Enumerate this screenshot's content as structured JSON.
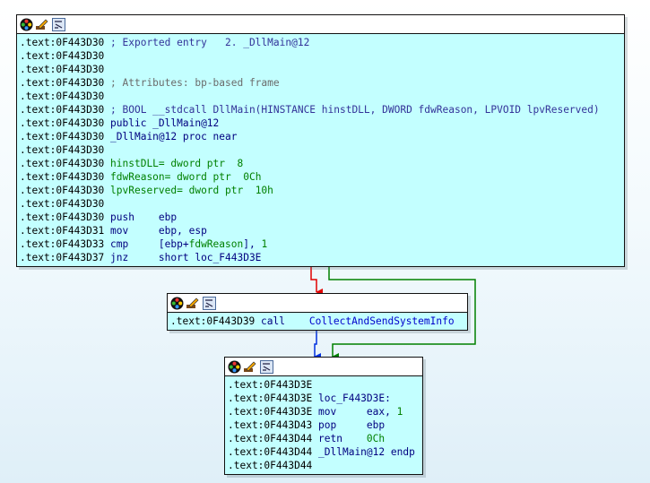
{
  "icons": [
    "color-palette-icon",
    "edit-pencil-icon",
    "graph-layout-icon"
  ],
  "colors": {
    "block_bg": "#c3ffff",
    "edge_true": "#e00000",
    "edge_false": "#008000",
    "edge_uncond": "#0030e0"
  },
  "block1": {
    "lines": [
      {
        "addr": ".text:0F443D30",
        "text": " ; Exported entry   2. _DllMain@12"
      },
      {
        "addr": ".text:0F443D30",
        "text": ""
      },
      {
        "addr": ".text:0F443D30",
        "text": ""
      },
      {
        "addr": ".text:0F443D30",
        "text": " ; Attributes: bp-based frame"
      },
      {
        "addr": ".text:0F443D30",
        "text": ""
      },
      {
        "addr": ".text:0F443D30",
        "text": " ; BOOL __stdcall DllMain(HINSTANCE hinstDLL, DWORD fdwReason, LPVOID lpvReserved)"
      },
      {
        "addr": ".text:0F443D30",
        "text": " public _DllMain@12"
      },
      {
        "addr": ".text:0F443D30",
        "text": " _DllMain@12 proc near"
      },
      {
        "addr": ".text:0F443D30",
        "text": ""
      },
      {
        "addr": ".text:0F443D30",
        "text": " hinstDLL= dword ptr  8"
      },
      {
        "addr": ".text:0F443D30",
        "text": " fdwReason= dword ptr  0Ch"
      },
      {
        "addr": ".text:0F443D30",
        "text": " lpvReserved= dword ptr  10h"
      },
      {
        "addr": ".text:0F443D30",
        "text": ""
      },
      {
        "addr": ".text:0F443D30",
        "text": " push    ebp"
      },
      {
        "addr": ".text:0F443D31",
        "text": " mov     ebp, esp"
      },
      {
        "addr": ".text:0F443D33",
        "text": " cmp     [ebp+fdwReason], 1"
      },
      {
        "addr": ".text:0F443D37",
        "text": " jnz     short loc_F443D3E"
      }
    ]
  },
  "block2": {
    "lines": [
      {
        "addr": ".text:0F443D39",
        "text": " call    CollectAndSendSystemInfo"
      }
    ]
  },
  "block3": {
    "lines": [
      {
        "addr": ".text:0F443D3E",
        "text": ""
      },
      {
        "addr": ".text:0F443D3E",
        "text": " loc_F443D3E:"
      },
      {
        "addr": ".text:0F443D3E",
        "text": " mov     eax, 1"
      },
      {
        "addr": ".text:0F443D43",
        "text": " pop     ebp"
      },
      {
        "addr": ".text:0F443D44",
        "text": " retn    0Ch"
      },
      {
        "addr": ".text:0F443D44",
        "text": " _DllMain@12 endp"
      },
      {
        "addr": ".text:0F443D44",
        "text": ""
      }
    ]
  }
}
